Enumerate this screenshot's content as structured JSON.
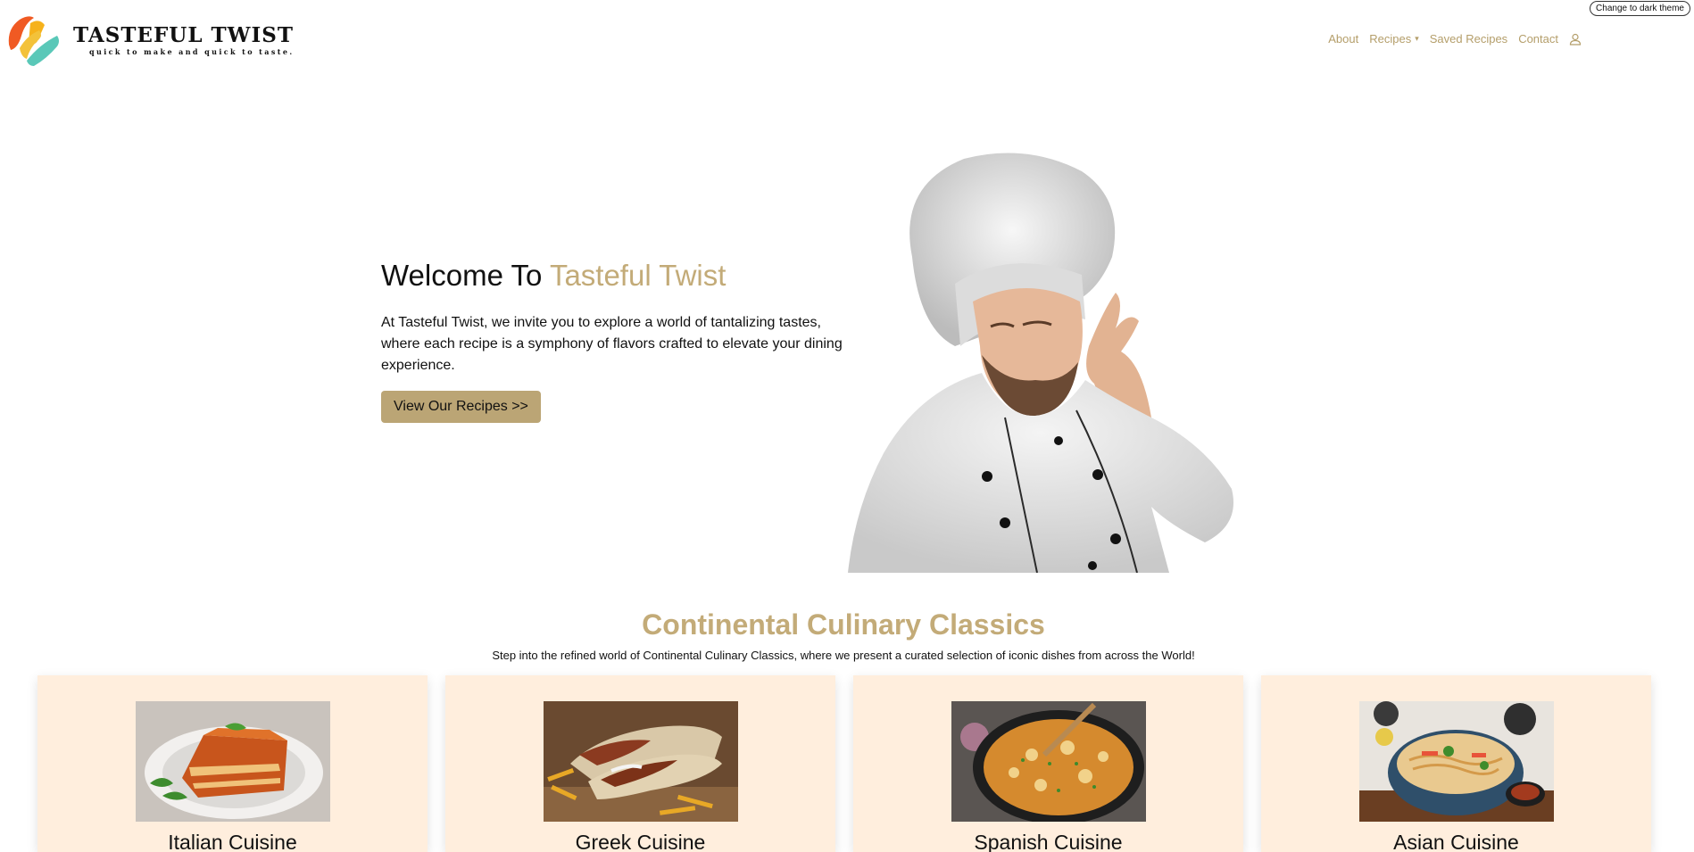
{
  "theme_toggle": {
    "label": "Change to dark theme"
  },
  "brand": {
    "name": "TASTEFUL TWIST",
    "tagline": "quick to make and quick to taste."
  },
  "nav": {
    "items": [
      {
        "label": "About"
      },
      {
        "label": "Recipes",
        "has_dropdown": true
      },
      {
        "label": "Saved Recipes"
      },
      {
        "label": "Contact"
      }
    ],
    "user_icon": "user-icon"
  },
  "hero": {
    "title_prefix": "Welcome To ",
    "title_accent": "Tasteful Twist",
    "description": "At Tasteful Twist, we invite you to explore a world of tantalizing tastes, where each recipe is a symphony of flavors crafted to elevate your dining experience.",
    "button_label": "View Our Recipes >>",
    "image": "chef-gesture-image"
  },
  "section": {
    "title": "Continental Culinary Classics",
    "subtitle": "Step into the refined world of Continental Culinary Classics, where we present a curated selection of iconic dishes from across the World!"
  },
  "cuisines": [
    {
      "title": "Italian Cuisine",
      "image": "lasagna-image"
    },
    {
      "title": "Greek Cuisine",
      "image": "gyro-wraps-image"
    },
    {
      "title": "Spanish Cuisine",
      "image": "paella-image"
    },
    {
      "title": "Asian Cuisine",
      "image": "noodle-bowl-image"
    }
  ],
  "colors": {
    "accent": "#c3ab78",
    "nav_link": "#b49e6a",
    "button": "#bba575",
    "card_bg": "#ffeedd"
  }
}
